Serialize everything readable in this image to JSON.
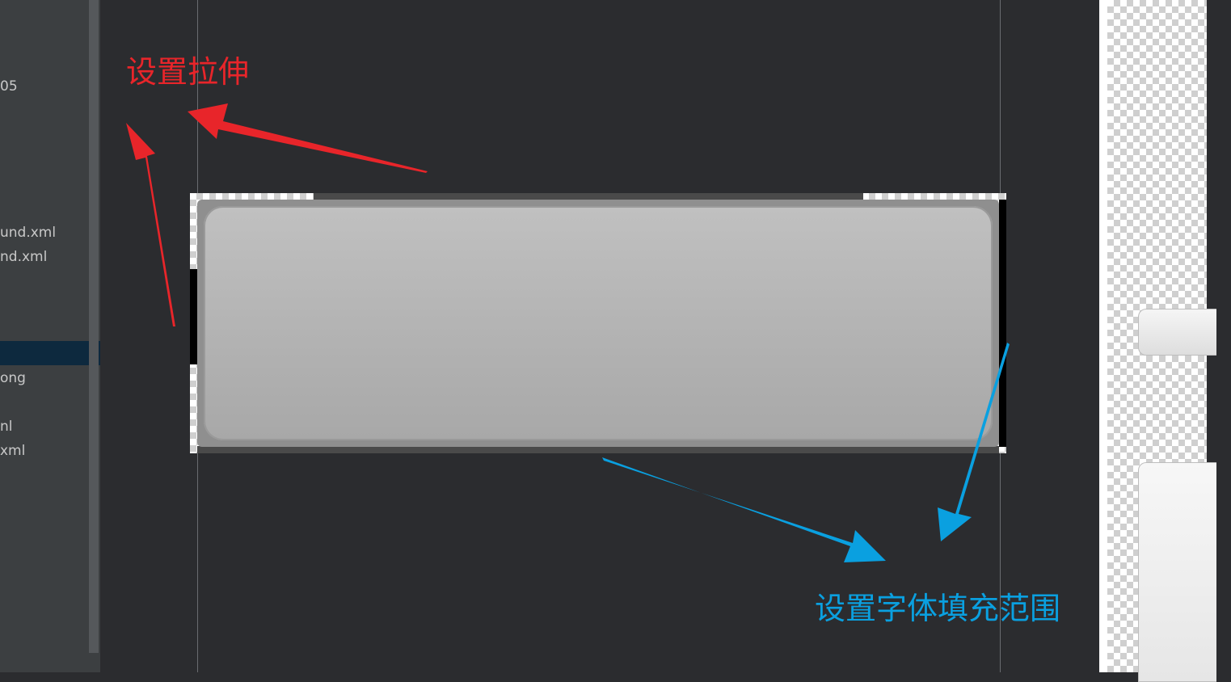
{
  "sidebar": {
    "items": [
      {
        "label": "05"
      },
      {
        "label": "und.xml"
      },
      {
        "label": "nd.xml"
      },
      {
        "label": ""
      },
      {
        "label": "ong"
      },
      {
        "label": "nl"
      },
      {
        "label": "xml"
      }
    ]
  },
  "annotations": {
    "stretch_label": "设置拉伸",
    "content_label": "设置字体填充范围"
  },
  "colors": {
    "stretch_arrow": "#e8252a",
    "content_arrow": "#0aa0e0",
    "canvas_bg": "#2b2c2f",
    "panel_bg": "#3c3f41",
    "selection": "#0d293e"
  },
  "icons": {
    "stretch_arrows": "red-arrow-icon",
    "content_arrows": "blue-arrow-icon"
  }
}
